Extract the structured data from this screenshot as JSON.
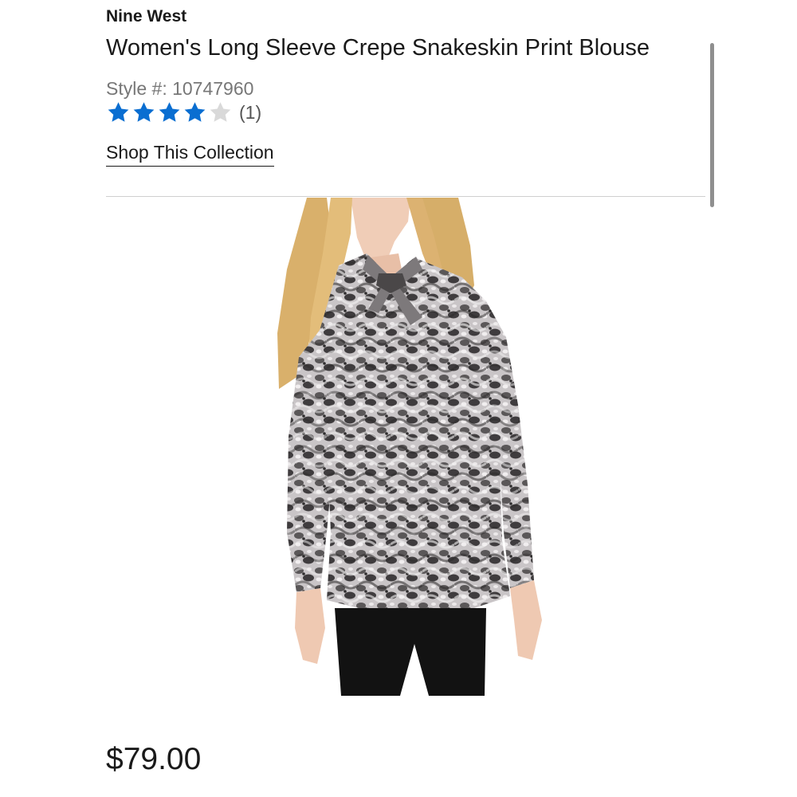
{
  "product": {
    "brand": "Nine West",
    "title": "Women's Long Sleeve Crepe Snakeskin Print Blouse",
    "style_label": "Style #: 10747960",
    "rating": {
      "value": 4,
      "max": 5,
      "count_label": "(1)",
      "filled_color": "#0a6ed1",
      "empty_color": "#d9d9d9"
    },
    "collection_link": "Shop This Collection",
    "price": "$79.00",
    "image": {
      "icon": "product-photo-blouse"
    }
  }
}
